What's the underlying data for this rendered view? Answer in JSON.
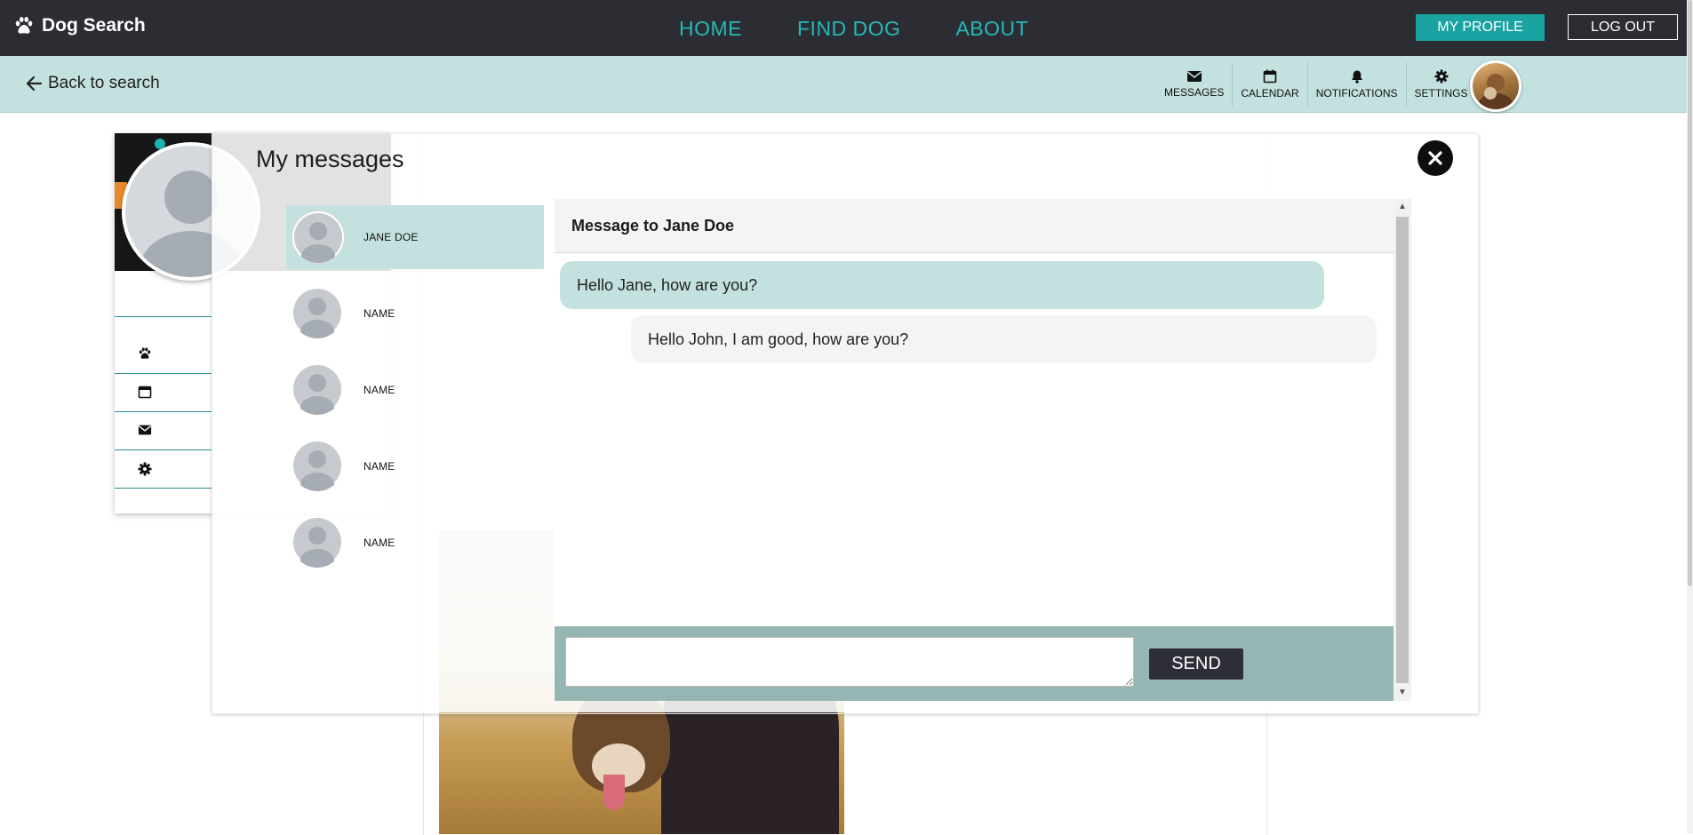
{
  "brand": {
    "name": "Dog Search"
  },
  "nav": {
    "links": [
      "HOME",
      "FIND DOG",
      "ABOUT"
    ]
  },
  "header_buttons": {
    "profile": "MY PROFILE",
    "logout": "LOG OUT"
  },
  "subbar": {
    "back_label": "Back to search",
    "tools": [
      {
        "label": "MESSAGES",
        "icon": "envelope-icon"
      },
      {
        "label": "CALENDAR",
        "icon": "calendar-icon"
      },
      {
        "label": "NOTIFICATIONS",
        "icon": "bell-icon"
      },
      {
        "label": "SETTINGS",
        "icon": "gear-icon"
      }
    ]
  },
  "background_page": {
    "sidebar_icons": [
      "paw-icon",
      "calendar-icon",
      "envelope-icon",
      "gear-icon"
    ]
  },
  "modal": {
    "title": "My messages",
    "contacts": [
      {
        "name": "JANE DOE",
        "active": true
      },
      {
        "name": "NAME",
        "active": false
      },
      {
        "name": "NAME",
        "active": false
      },
      {
        "name": "NAME",
        "active": false
      },
      {
        "name": "NAME",
        "active": false
      }
    ],
    "chat": {
      "title": "Message to Jane Doe",
      "messages": [
        {
          "direction": "out",
          "text": "Hello Jane, how are you?"
        },
        {
          "direction": "in",
          "text": "Hello John, I am good, how are you?"
        }
      ],
      "input_value": "",
      "send_label": "SEND"
    }
  },
  "colors": {
    "navbar": "#2b2d33",
    "accent_teal": "#1aa3a3",
    "nav_link": "#25b8b8",
    "subbar": "#c3e1df",
    "composer": "#96b6b4",
    "send_button": "#2e2e38"
  }
}
